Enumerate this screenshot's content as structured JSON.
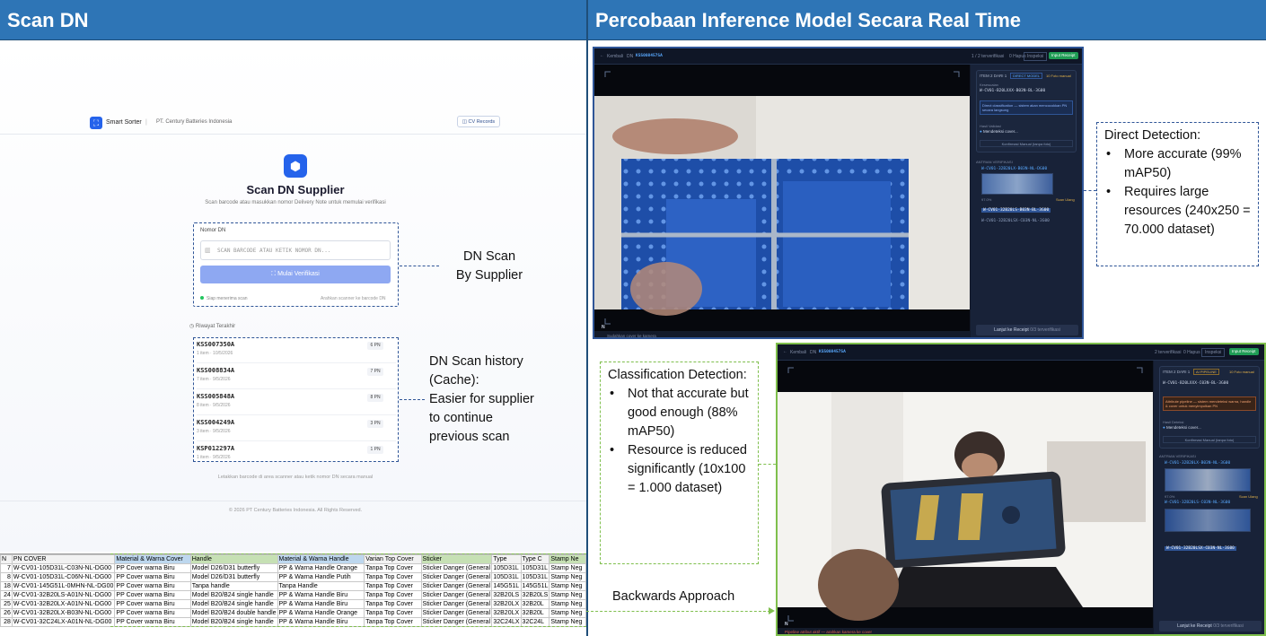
{
  "headers": {
    "left": "Scan DN",
    "right": "Percobaan Inference Model Secara Real Time"
  },
  "app": {
    "brand": "Smart Sorter",
    "company": "PT. Century Batteries Indonesia",
    "cv_records": "CV Records",
    "title": "Scan DN Supplier",
    "subtitle": "Scan barcode atau masukkan nomor Delivery Note untuk memulai verifikasi",
    "field_label": "Nomor DN",
    "input_placeholder": "SCAN BARCODE ATAU KETIK NOMOR DN...",
    "button": "Mulai Verifikasi",
    "status_left": "Siap menerima scan",
    "status_right": "Arahkan scanner ke barcode DN",
    "history_title": "Riwayat Terakhir",
    "history": [
      {
        "code": "KSS007350A",
        "meta": "1 item · 10/5/2026",
        "pn": "6 PN"
      },
      {
        "code": "KSS008834A",
        "meta": "7 item · 9/5/2026",
        "pn": "7 PN"
      },
      {
        "code": "KSS005848A",
        "meta": "8 item · 9/5/2026",
        "pn": "8 PN"
      },
      {
        "code": "KSS004249A",
        "meta": "3 item · 9/5/2026",
        "pn": "3 PN"
      },
      {
        "code": "KSP012297A",
        "meta": "1 item · 9/5/2026",
        "pn": "1 PN"
      }
    ],
    "footer_hint": "Letakkan barcode di area scanner atau ketik nomor DN secara manual",
    "copyright": "© 2026 PT Century Batteries Indonesia. All Rights Reserved."
  },
  "annotations": {
    "dn_scan": [
      "DN Scan",
      "By Supplier"
    ],
    "history": [
      "DN Scan history",
      "(Cache):",
      "Easier for supplier",
      "to continue",
      "previous scan"
    ],
    "direct": {
      "title": "Direct Detection:",
      "bullets": [
        "More accurate (99% mAP50)",
        "Requires large resources (240x250 = 70.000 dataset)"
      ]
    },
    "classification": {
      "title": "Classification Detection:",
      "bullets": [
        "Not that accurate but good enough (88% mAP50)",
        "Resource is reduced significantly (10x100 = 1.000 dataset)"
      ]
    },
    "backwards": "Backwards Approach"
  },
  "sheet": {
    "headers": [
      "N",
      "PN COVER",
      "Material & Warna Cover",
      "Handle",
      "Material & Warna Handle",
      "Varian Top Cover",
      "Sticker",
      "Type",
      "Type C",
      "Stamp Ne"
    ],
    "rows": [
      [
        "7",
        "W-CV01-105D31L-C03N-NL-DG00",
        "PP Cover warna Biru",
        "Model D26/D31 butterfly",
        "PP & Warna Handle Orange",
        "Tanpa Top Cover",
        "Sticker Danger (General",
        "105D31L",
        "105D31L",
        "Stamp Neg"
      ],
      [
        "8",
        "W-CV01-105D31L-C06N-NL-DG00",
        "PP Cover warna Biru",
        "Model D26/D31 butterfly",
        "PP & Warna Handle Putih",
        "Tanpa Top Cover",
        "Sticker Danger (General",
        "105D31L",
        "105D31L",
        "Stamp Neg"
      ],
      [
        "18",
        "W-CV01-145G51L-0MHN-NL-DG00",
        "PP Cover warna Biru",
        "Tanpa handle",
        "Tanpa Handle",
        "Tanpa Top Cover",
        "Sticker Danger (General",
        "145G51L",
        "145G51L",
        "Stamp Neg"
      ],
      [
        "24",
        "W-CV01-32B20LS-A01N-NL-DG00",
        "PP Cover warna Biru",
        "Model B20/B24 single handle",
        "PP & Warna Handle Biru",
        "Tanpa Top Cover",
        "Sticker Danger (General",
        "32B20LS",
        "32B20LS",
        "Stamp Neg"
      ],
      [
        "25",
        "W-CV01-32B20LX-A01N-NL-DG00",
        "PP Cover warna Biru",
        "Model B20/B24 single handle",
        "PP & Warna Handle Biru",
        "Tanpa Top Cover",
        "Sticker Danger (General",
        "32B20LX",
        "32B20L",
        "Stamp Neg"
      ],
      [
        "26",
        "W-CV01-32B20LX-B03N-NL-DG00",
        "PP Cover warna Biru",
        "Model B20/B24 double handle",
        "PP & Warna Handle Orange",
        "Tanpa Top Cover",
        "Sticker Danger (General",
        "32B20LX",
        "32B20L",
        "Stamp Neg"
      ],
      [
        "28",
        "W-CV01-32C24LX-A01N-NL-DG00",
        "PP Cover warna Biru",
        "Model B20/B24 single handle",
        "PP & Warna Handle Biru",
        "Tanpa Top Cover",
        "Sticker Danger (General",
        "32C24LX",
        "32C24L",
        "Stamp Neg"
      ]
    ]
  },
  "shot1": {
    "back": "Kembali",
    "dn_label": "DN",
    "dn": "KSS008457SA",
    "top_right": [
      "1 / 2 terverifikasi",
      "0 Hapus",
      "Inspeksi",
      "Input Receipt"
    ],
    "item_label": "ITEM 2 DARI 1",
    "item_mode": "DIRECT MODEL",
    "photo_count": "10 Foto manual",
    "sku_label": "Kesesuaian",
    "sku": "W-CV01-B20LXXX-B03N-BL-3G00",
    "info": "Direct classification — sistem akan mencocokkan PN secara langsung",
    "status_label": "Hasil Validasi",
    "status": "Mendeteksi cover...",
    "confirm": "Konfirmasi Manual (tanpa foto)",
    "queue_label": "ANTRIAN VERIFIKASI",
    "queue": [
      "W-CV01-32B20LX-B03N-NL-DG00",
      "W-CV01-32B20LS-B03N-BL-3G00",
      "W-CV01-32B20LSX-C03N-NL-3G00"
    ],
    "confidence": "97.0%",
    "thumb_tag": "Scan Ulang",
    "bottom_left": "Sudahkan cover ke kamera",
    "bottom_btn": "Lanjut ke Receipt",
    "bottom_count": "0/3 terverifikasi",
    "corner": "N"
  },
  "shot2": {
    "back": "Kembali",
    "dn_label": "DN",
    "dn": "KSS008457SA",
    "top_right": [
      "2 terverifikasi",
      "0 Hapus",
      "Inspeksi",
      "Input Receipt"
    ],
    "item_label": "ITEM 2 DARI 1",
    "item_mode": "AI PIPELINE",
    "photo_count": "10 Foto manual",
    "sku": "W-CV01-B20LXXX-C03N-BL-3G00",
    "info": "Attribute pipeline — sistem mendeteksi warna, handle & cover untuk menyimpulkan PN",
    "status_label": "Hasil Deteksi",
    "status": "Mendeteksi cover...",
    "confirm": "Konfirmasi Manual (tanpa foto)",
    "queue_label": "ANTRIAN VERIFIKASI",
    "queue": [
      "W-CV01-32B20LX-B03N-NL-3G00",
      "W-CV01-32B20LS-C03N-NL-3G00",
      "W-CV01-32B20LSX-C03N-NL-3G00"
    ],
    "confidence": "97.0%",
    "thumb_tag": "Scan Ulang",
    "bottom_left": "Pipeline atribut aktif — arahkan kamera ke cover",
    "bottom_btn": "Lanjut ke Receipt",
    "bottom_count": "0/3 terverifikasi",
    "corner": "N"
  }
}
